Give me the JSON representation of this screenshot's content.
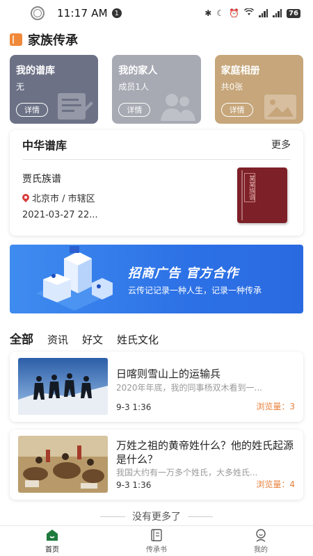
{
  "status_bar": {
    "time": "11:17 AM",
    "notification_count": "1",
    "battery": "76"
  },
  "section": {
    "title": "家族传承"
  },
  "cards": [
    {
      "title": "我的谱库",
      "subtitle": "无",
      "button": "详情",
      "color": "#6c7186"
    },
    {
      "title": "我的家人",
      "subtitle": "成员1人",
      "button": "详情",
      "color": "#a7a9b3"
    },
    {
      "title": "家庭相册",
      "subtitle": "共0张",
      "button": "详情",
      "color": "#c6a67a"
    }
  ],
  "library": {
    "title": "中华谱库",
    "more": "更多",
    "entry": {
      "name": "贾氏族谱",
      "location": "北京市 / 市辖区",
      "date": "2021-03-27 22...",
      "cover_label": "某某族谱"
    }
  },
  "banner": {
    "title": "招商广告  官方合作",
    "subtitle": "云传记记录一种人生，记录一种传承"
  },
  "tabs": [
    {
      "label": "全部",
      "active": true
    },
    {
      "label": "资讯",
      "active": false
    },
    {
      "label": "好文",
      "active": false
    },
    {
      "label": "姓氏文化",
      "active": false
    }
  ],
  "articles": [
    {
      "title": "日喀则雪山上的运输兵",
      "summary": "2020年年底，我的同事杨双木看到一...",
      "time": "9-3 1:36",
      "views": "浏览量：3"
    },
    {
      "title": "万姓之祖的黄帝姓什么？他的姓氏起源是什么？",
      "summary": "我国大约有一万多个姓氏，大多姓氏...",
      "time": "9-3 1:36",
      "views": "浏览量：4"
    }
  ],
  "footer_text": "没有更多了",
  "bottom_nav": [
    {
      "label": "首页",
      "icon": "home-icon",
      "active": true
    },
    {
      "label": "传承书",
      "icon": "book-icon",
      "active": false
    },
    {
      "label": "我的",
      "icon": "profile-icon",
      "active": false
    }
  ],
  "colors": {
    "accent_orange": "#e8803c",
    "banner_blue": "#2d71e6",
    "book_red": "#7e2027"
  }
}
